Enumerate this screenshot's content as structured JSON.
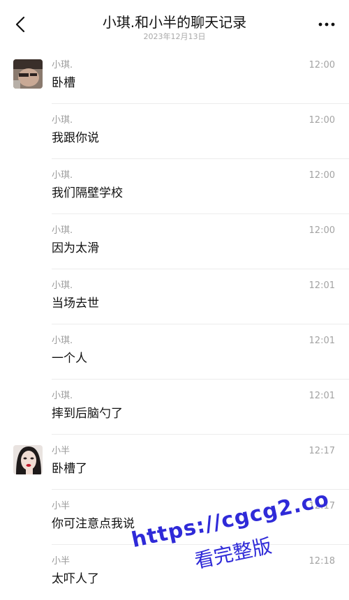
{
  "header": {
    "title": "小琪.和小半的聊天记录",
    "subtitle": "2023年12月13日",
    "back_icon": "chevron-left-icon",
    "more_icon": "more-horizontal-icon"
  },
  "messages": [
    {
      "sender": "小琪.",
      "time": "12:00",
      "text": "卧槽",
      "avatar": "xiaoqi"
    },
    {
      "sender": "小琪.",
      "time": "12:00",
      "text": "我跟你说"
    },
    {
      "sender": "小琪.",
      "time": "12:00",
      "text": "我们隔壁学校"
    },
    {
      "sender": "小琪.",
      "time": "12:00",
      "text": "因为太滑"
    },
    {
      "sender": "小琪.",
      "time": "12:01",
      "text": "当场去世"
    },
    {
      "sender": "小琪.",
      "time": "12:01",
      "text": "一个人"
    },
    {
      "sender": "小琪.",
      "time": "12:01",
      "text": "摔到后脑勺了"
    },
    {
      "sender": "小半",
      "time": "12:17",
      "text": "卧槽了",
      "avatar": "xiaoban"
    },
    {
      "sender": "小半",
      "time": "12:17",
      "text": "你可注意点我说"
    },
    {
      "sender": "小半",
      "time": "12:18",
      "text": "太吓人了"
    }
  ],
  "watermark": {
    "url": "https://cgcg2.co",
    "text": "看完整版"
  },
  "colors": {
    "watermark": "#2f2ad8",
    "divider": "#ececec",
    "meta_text": "#9a9a9a"
  }
}
